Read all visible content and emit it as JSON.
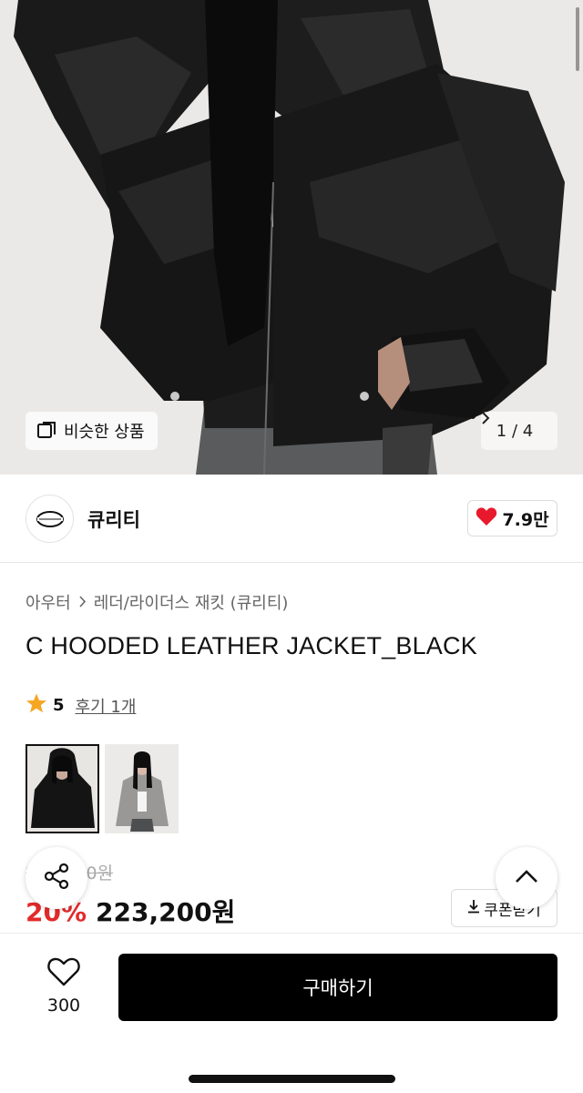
{
  "hero": {
    "similar_label": "비슷한 상품",
    "counter": "1 / 4",
    "similar_icon": "similar-products-icon",
    "next_icon": "chevron-right-icon"
  },
  "brand": {
    "name": "큐리티",
    "likes": "7.9만",
    "heart_color": "#e8192c"
  },
  "breadcrumb": {
    "category": "아우터",
    "subcategory": "레더/라이더스 재킷 (큐리티)"
  },
  "product": {
    "title": "C HOODED LEATHER JACKET_BLACK",
    "rating": "5",
    "review_text": "후기 1개",
    "star_color": "#f5a623"
  },
  "price": {
    "original": "279,000원",
    "discount": "20%",
    "sale": "223,200원",
    "coupon_label": "쿠폰받기",
    "discount_color": "#e22a2a"
  },
  "bottom": {
    "wish_count": "300",
    "buy_label": "구매하기"
  }
}
